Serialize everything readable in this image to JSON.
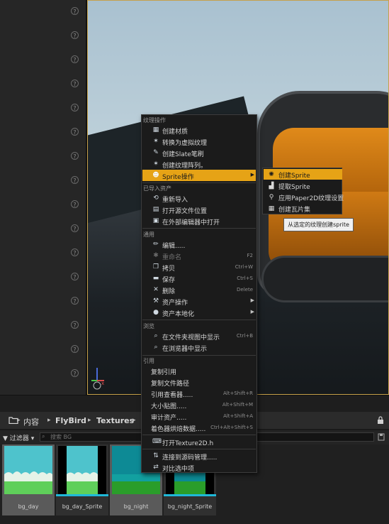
{
  "breadcrumb": {
    "items": [
      "内容",
      "FlyBird",
      "Textures"
    ]
  },
  "filter": {
    "button_label": "过滤器",
    "search_placeholder": "搜索 BG"
  },
  "assets": [
    {
      "name": "bg_day",
      "selected": true
    },
    {
      "name": "bg_day_Sprite",
      "selected": false
    },
    {
      "name": "bg_night",
      "selected": true
    },
    {
      "name": "bg_night_Sprite",
      "selected": false
    }
  ],
  "context_menu": {
    "sections": {
      "texture_actions": "纹理操作",
      "imported_asset": "已导入资产",
      "common": "通用",
      "explore": "浏览",
      "references": "引用"
    },
    "items": {
      "create_material": "创建材质",
      "convert_virtual_texture": "转换为虚拟纹理",
      "create_slate_brush": "创建Slate笔刷",
      "create_texture_array": "创建纹理阵列。",
      "sprite_actions": "Sprite操作",
      "reimport": "重新导入",
      "open_source_location": "打开源文件位置",
      "open_in_external_editor": "在外部编辑器中打开",
      "edit": "编辑.....",
      "rename": "重命名",
      "rename_shortcut": "F2",
      "copy": "拷贝",
      "copy_shortcut": "Ctrl+W",
      "save": "保存",
      "save_shortcut": "Ctrl+S",
      "delete": "删除",
      "delete_shortcut": "Delete",
      "asset_actions": "资产操作",
      "asset_localization": "资产本地化",
      "show_in_folder_view": "在文件夹视图中显示",
      "show_in_folder_view_shortcut": "Ctrl+B",
      "show_in_explorer": "在浏览器中显示",
      "copy_reference": "复制引用",
      "copy_file_path": "复制文件路径",
      "reference_viewer": "引用查看器.....",
      "reference_viewer_shortcut": "Alt+Shift+R",
      "size_map": "大小贴图.....",
      "size_map_shortcut": "Alt+Shift+M",
      "audit_assets": "审计资产.....",
      "audit_assets_shortcut": "Alt+Shift+A",
      "shader_cook_stats": "着色器烘焙数据.....",
      "shader_cook_stats_shortcut": "Ctrl+Alt+Shift+S",
      "open_texture2d_h": "打开Texture2D.h",
      "connect_source_control": "连接到源码管理.....",
      "diff_selected": "对比选中项"
    }
  },
  "sprite_submenu": {
    "items": [
      "创建Sprite",
      "提取Sprite",
      "应用Paper2D纹理设置",
      "创建瓦片集"
    ]
  },
  "tooltip": "从选定的纹理创建sprite",
  "colors": {
    "highlight": "#e6a316",
    "menu_bg": "#1b1b1b",
    "viewport_border": "#c6a14a"
  }
}
